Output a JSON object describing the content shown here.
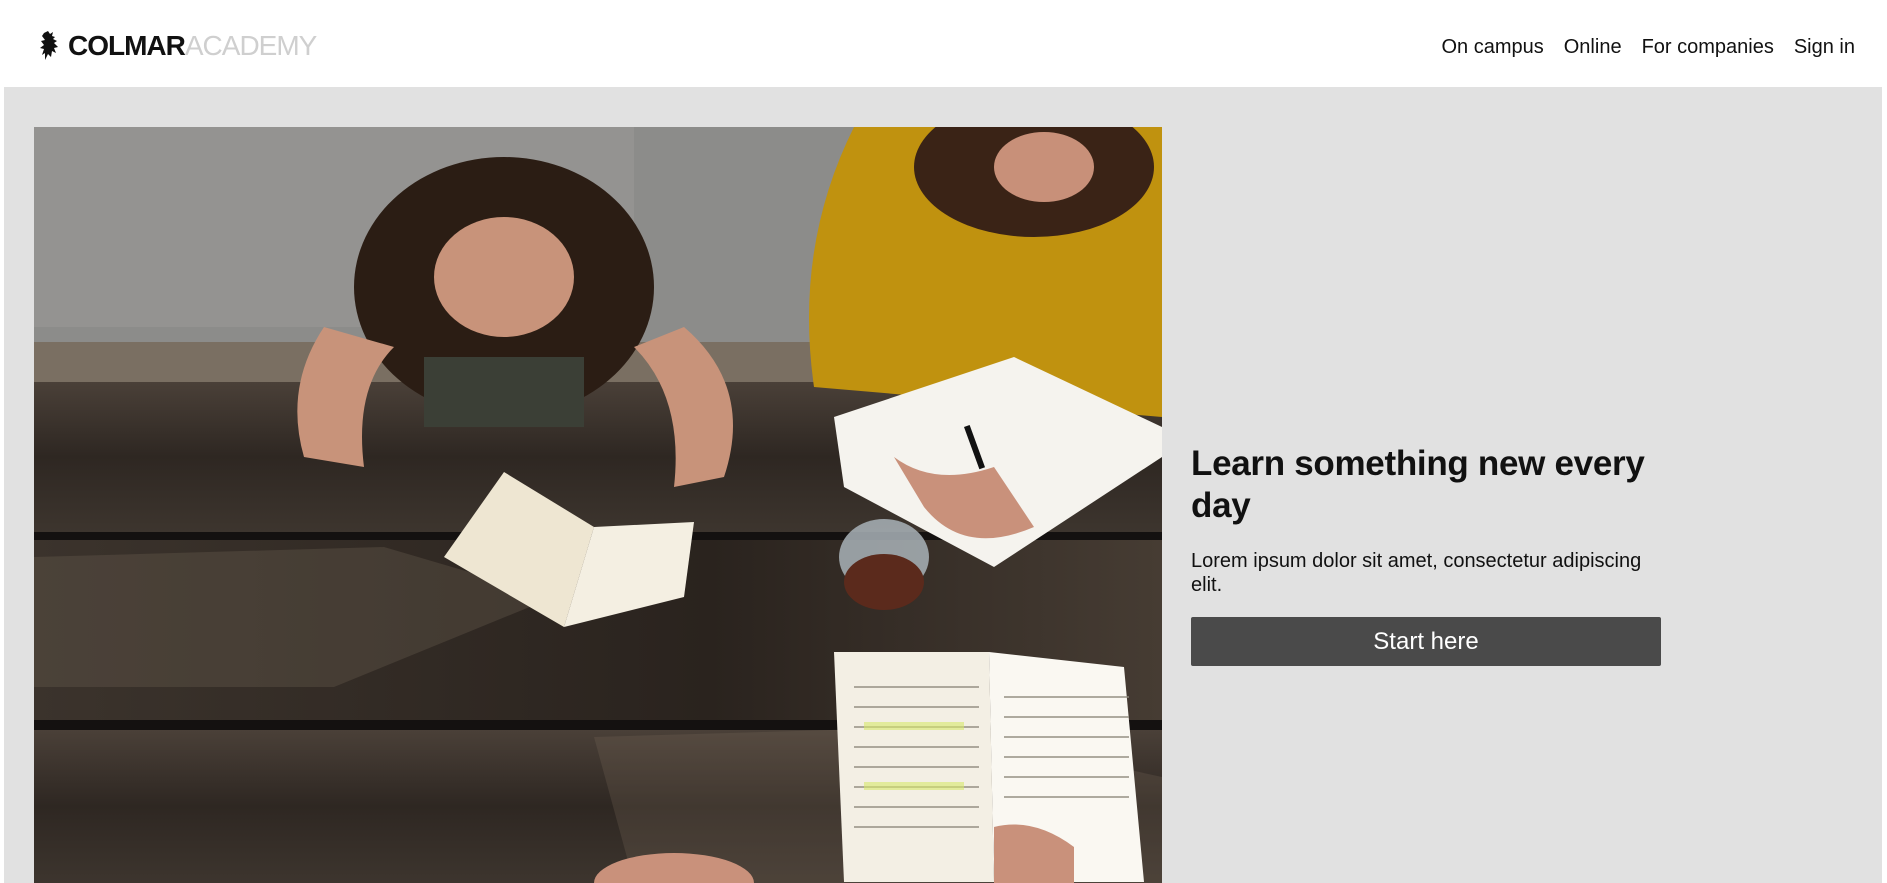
{
  "header": {
    "logo_bold": "COLMAR",
    "logo_light": "ACADEMY",
    "logo_icon": "lion-rampant-icon"
  },
  "nav": {
    "items": [
      {
        "label": "On campus"
      },
      {
        "label": "Online"
      },
      {
        "label": "For companies"
      },
      {
        "label": "Sign in"
      }
    ]
  },
  "hero": {
    "image_subject": "students-reading-at-picnic-table-photo",
    "title": "Learn something new every day",
    "text": "Lorem ipsum dolor sit amet, consectetur adipiscing elit.",
    "cta_label": "Start here"
  },
  "colors": {
    "page_bg": "#e1e1e1",
    "header_bg": "#ffffff",
    "button_bg": "#4a4a4a",
    "logo_light": "#cfcfcf"
  }
}
